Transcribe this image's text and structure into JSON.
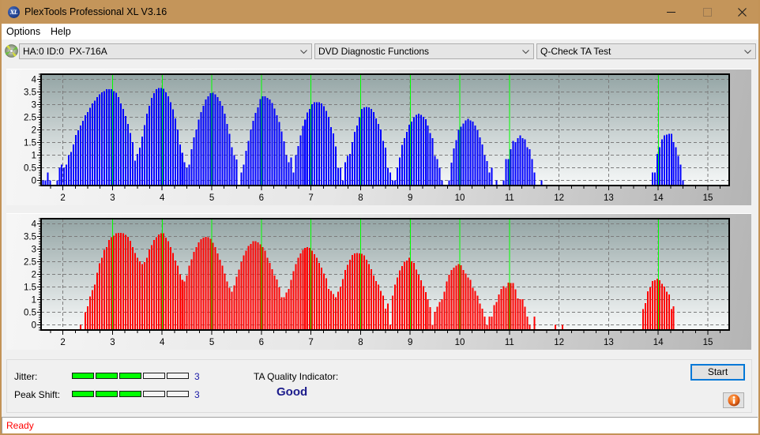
{
  "window": {
    "title": "PlexTools Professional XL V3.16",
    "icon_text": "XL"
  },
  "menu": {
    "items": [
      {
        "label": "Options"
      },
      {
        "label": "Help"
      }
    ]
  },
  "toolbar": {
    "drive": {
      "icon": "disc-icon",
      "value": "HA:0 ID:0  PX-716A"
    },
    "function": {
      "value": "DVD Diagnostic Functions"
    },
    "test": {
      "value": "Q-Check TA Test"
    }
  },
  "chart_data": [
    {
      "type": "bar",
      "title": "",
      "xlabel": "",
      "ylabel": "",
      "xlim": [
        1.56,
        15.43
      ],
      "ylim": [
        -0.2,
        4.2
      ],
      "x_ticks": [
        2,
        3,
        4,
        5,
        6,
        7,
        8,
        9,
        10,
        11,
        12,
        13,
        14,
        15
      ],
      "y_ticks": [
        0,
        0.5,
        1,
        1.5,
        2,
        2.5,
        3,
        3.5,
        4
      ],
      "grid": true,
      "marker_lines": [
        3,
        4,
        5,
        6,
        7,
        8,
        9,
        10,
        11,
        14
      ],
      "marker_color": "#00FF00",
      "bins_per_unit": 21,
      "series": [
        {
          "name": "upper histogram",
          "color": "#0000FF",
          "bins": [
            {
              "from": 1,
              "values": [
                null,
                null,
                null,
                null,
                null,
                null,
                null,
                null,
                null,
                null,
                null,
                null,
                0,
                0,
                0.31,
                0,
                null,
                null,
                0,
                0.5,
                0.62
              ]
            },
            {
              "from": 2,
              "values": [
                0.5,
                0.62,
                1.0,
                1.12,
                1.43,
                1.8,
                1.98,
                2.17,
                2.36,
                2.57,
                2.7,
                2.87,
                3.04,
                3.16,
                3.29,
                3.41,
                3.49,
                3.53,
                3.6,
                3.6,
                3.6
              ]
            },
            {
              "from": 3,
              "values": [
                3.53,
                3.47,
                3.3,
                3.04,
                2.83,
                2.54,
                2.23,
                1.88,
                1.51,
                0.79,
                1.05,
                1.3,
                1.74,
                2.19,
                2.64,
                2.95,
                3.26,
                3.45,
                3.6,
                3.66,
                3.66
              ]
            },
            {
              "from": 4,
              "values": [
                3.62,
                3.49,
                3.33,
                3.1,
                2.81,
                2.46,
                2.02,
                1.43,
                1.1,
                0.72,
                0.5,
                0.62,
                1.24,
                1.71,
                2.02,
                2.4,
                2.7,
                2.95,
                3.2,
                3.33,
                3.45
              ]
            },
            {
              "from": 5,
              "values": [
                3.47,
                3.41,
                3.3,
                3.14,
                2.95,
                2.64,
                2.23,
                1.84,
                1.32,
                1.0,
                0.83,
                null,
                0.31,
                0.62,
                1.18,
                1.57,
                2.02,
                2.36,
                2.67,
                2.89,
                3.22
              ]
            },
            {
              "from": 6,
              "values": [
                3.33,
                3.33,
                3.26,
                3.2,
                3.06,
                2.85,
                2.58,
                2.31,
                1.94,
                1.55,
                1.0,
                0.72,
                0.91,
                0.31,
                1.0,
                1.36,
                1.78,
                2.15,
                2.4,
                2.69,
                2.83
              ]
            },
            {
              "from": 7,
              "values": [
                3.02,
                3.1,
                3.1,
                3.1,
                3.04,
                2.93,
                2.75,
                2.52,
                2.11,
                1.86,
                1.34,
                0.5,
                0.5,
                0,
                0.72,
                0.97,
                1.05,
                1.51,
                1.92,
                2.17,
                2.5
              ]
            },
            {
              "from": 8,
              "values": [
                2.83,
                2.89,
                2.91,
                2.89,
                2.83,
                2.7,
                2.46,
                2.23,
                2.02,
                1.57,
                1.3,
                0.5,
                0.31,
                0,
                0,
                0.5,
                0.91,
                1.4,
                1.67,
                1.92,
                2.21
              ]
            },
            {
              "from": 9,
              "values": [
                2.33,
                2.5,
                2.6,
                2.64,
                2.6,
                2.52,
                2.42,
                2.17,
                1.88,
                1.67,
                0.97,
                0.85,
                0.5,
                0,
                null,
                null,
                0,
                0.7,
                1.26,
                1.6,
                2.0
              ]
            },
            {
              "from": 10,
              "values": [
                2.13,
                2.25,
                2.38,
                2.44,
                2.38,
                2.33,
                2.17,
                2.0,
                1.71,
                1.43,
                1.0,
                0.76,
                0.31,
                0.5,
                null,
                0,
                null,
                null,
                0,
                0.85,
                0.85
              ]
            },
            {
              "from": 11,
              "values": [
                1.24,
                1.57,
                1.51,
                1.67,
                1.78,
                1.67,
                1.63,
                1.32,
                1.24,
                0.85,
                0.31,
                null,
                null,
                0,
                null,
                null,
                null,
                null,
                null,
                null,
                null
              ]
            },
            {
              "from": 13,
              "values": [
                null,
                null,
                null,
                null,
                null,
                null,
                null,
                null,
                null,
                null,
                null,
                null,
                null,
                null,
                null,
                null,
                null,
                null,
                0.31,
                0.31,
                1.05
              ]
            },
            {
              "from": 14,
              "values": [
                1.32,
                1.63,
                1.78,
                1.82,
                1.85,
                1.85,
                1.52,
                1.32,
                0.97,
                0.62,
                0,
                null,
                null,
                null,
                null,
                null,
                null,
                null,
                null,
                null,
                null
              ]
            }
          ]
        }
      ]
    },
    {
      "type": "bar",
      "title": "",
      "xlabel": "",
      "ylabel": "",
      "xlim": [
        1.56,
        15.43
      ],
      "ylim": [
        -0.2,
        4.2
      ],
      "x_ticks": [
        2,
        3,
        4,
        5,
        6,
        7,
        8,
        9,
        10,
        11,
        12,
        13,
        14,
        15
      ],
      "y_ticks": [
        0,
        0.5,
        1,
        1.5,
        2,
        2.5,
        3,
        3.5,
        4
      ],
      "grid": true,
      "marker_lines": [
        3,
        4,
        5,
        6,
        7,
        8,
        9,
        10,
        11,
        14
      ],
      "marker_color": "#00FF00",
      "bins_per_unit": 21,
      "series": [
        {
          "name": "lower histogram",
          "color": "#FF0000",
          "bins": [
            {
              "from": 2,
              "values": [
                null,
                null,
                null,
                null,
                null,
                null,
                null,
                0,
                null,
                0.5,
                0.73,
                1.13,
                1.37,
                1.59,
                2.06,
                2.44,
                2.65,
                2.96,
                3.08,
                3.35,
                3.47
              ]
            },
            {
              "from": 3,
              "values": [
                3.53,
                3.62,
                3.64,
                3.64,
                3.62,
                3.56,
                3.49,
                3.33,
                3.08,
                2.85,
                2.65,
                2.52,
                2.4,
                2.48,
                2.65,
                2.98,
                3.16,
                3.35,
                3.47,
                3.58,
                3.62
              ]
            },
            {
              "from": 4,
              "values": [
                3.62,
                3.45,
                3.31,
                3.08,
                2.85,
                2.54,
                2.34,
                2.0,
                1.78,
                1.72,
                1.96,
                2.34,
                2.6,
                2.89,
                3.08,
                3.27,
                3.39,
                3.45,
                3.49,
                3.47,
                3.41
              ]
            },
            {
              "from": 5,
              "values": [
                3.25,
                3.08,
                2.83,
                2.58,
                2.34,
                2.03,
                1.72,
                1.47,
                1.32,
                1.57,
                1.9,
                2.19,
                2.5,
                2.75,
                2.94,
                3.12,
                3.2,
                3.31,
                3.31,
                3.27,
                3.18
              ]
            },
            {
              "from": 6,
              "values": [
                3.08,
                2.94,
                2.65,
                2.46,
                2.21,
                1.96,
                1.8,
                1.49,
                1.1,
                1.1,
                1.28,
                1.43,
                1.78,
                2.13,
                2.4,
                2.65,
                2.83,
                2.96,
                3.04,
                3.08,
                3.04
              ]
            },
            {
              "from": 7,
              "values": [
                2.94,
                2.79,
                2.65,
                2.46,
                2.27,
                2.03,
                1.84,
                1.43,
                1.34,
                1.22,
                1.1,
                1.32,
                1.51,
                1.82,
                2.17,
                2.38,
                2.58,
                2.77,
                2.83,
                2.85,
                2.83
              ]
            },
            {
              "from": 8,
              "values": [
                2.81,
                2.75,
                2.58,
                2.4,
                2.21,
                1.96,
                1.74,
                1.59,
                1.34,
                1.16,
                0.64,
                0.85,
                0,
                1.16,
                1.59,
                1.88,
                2.15,
                2.32,
                2.5,
                2.54,
                2.65
              ]
            },
            {
              "from": 9,
              "values": [
                2.52,
                2.46,
                2.19,
                1.98,
                1.76,
                1.53,
                1.3,
                1.01,
                0.7,
                0,
                0.52,
                0.72,
                0.91,
                1.01,
                1.32,
                1.72,
                1.98,
                2.17,
                2.27,
                2.34,
                2.4
              ]
            },
            {
              "from": 10,
              "values": [
                2.36,
                2.17,
                2.03,
                1.88,
                1.78,
                1.47,
                1.34,
                1.16,
                0.85,
                0.64,
                0.33,
                0,
                0.33,
                0.33,
                0.79,
                0.91,
                1.2,
                1.43,
                1.53,
                1.47,
                1.67
              ]
            },
            {
              "from": 11,
              "values": [
                1.65,
                1.65,
                1.41,
                1.05,
                1.01,
                1.01,
                0.72,
                0.33,
                0,
                null,
                0.33,
                null,
                null,
                null,
                null,
                null,
                null,
                null,
                null,
                0,
                null
              ]
            },
            {
              "from": 12,
              "values": [
                null,
                0,
                null,
                null,
                null,
                null,
                null,
                null,
                null,
                null,
                null,
                null,
                null,
                null,
                null,
                null,
                null,
                null,
                null,
                null,
                null
              ]
            },
            {
              "from": 13,
              "values": [
                null,
                null,
                null,
                null,
                null,
                null,
                null,
                null,
                null,
                null,
                null,
                null,
                null,
                null,
                0.63,
                0.86,
                1.33,
                1.48,
                1.73,
                1.77,
                1.83
              ]
            },
            {
              "from": 14,
              "values": [
                1.77,
                1.62,
                1.52,
                1.31,
                1.21,
                0.63,
                0.73,
                null,
                null,
                null,
                null,
                null,
                null,
                null,
                null,
                null,
                null,
                null,
                null,
                null,
                null
              ]
            }
          ]
        }
      ]
    }
  ],
  "results": {
    "jitter": {
      "label": "Jitter:",
      "level": 3,
      "max_level": 5,
      "value": "3"
    },
    "peak_shift": {
      "label": "Peak Shift:",
      "level": 3,
      "max_level": 5,
      "value": "3"
    },
    "meter_fill_color": "#00FF00",
    "ta_quality": {
      "label": "TA Quality Indicator:",
      "value": "Good",
      "color": "#1C1C8C"
    }
  },
  "actions": {
    "start_label": "Start",
    "info_icon": "info-icon"
  },
  "status": {
    "text": "Ready",
    "color": "#FF0000"
  }
}
